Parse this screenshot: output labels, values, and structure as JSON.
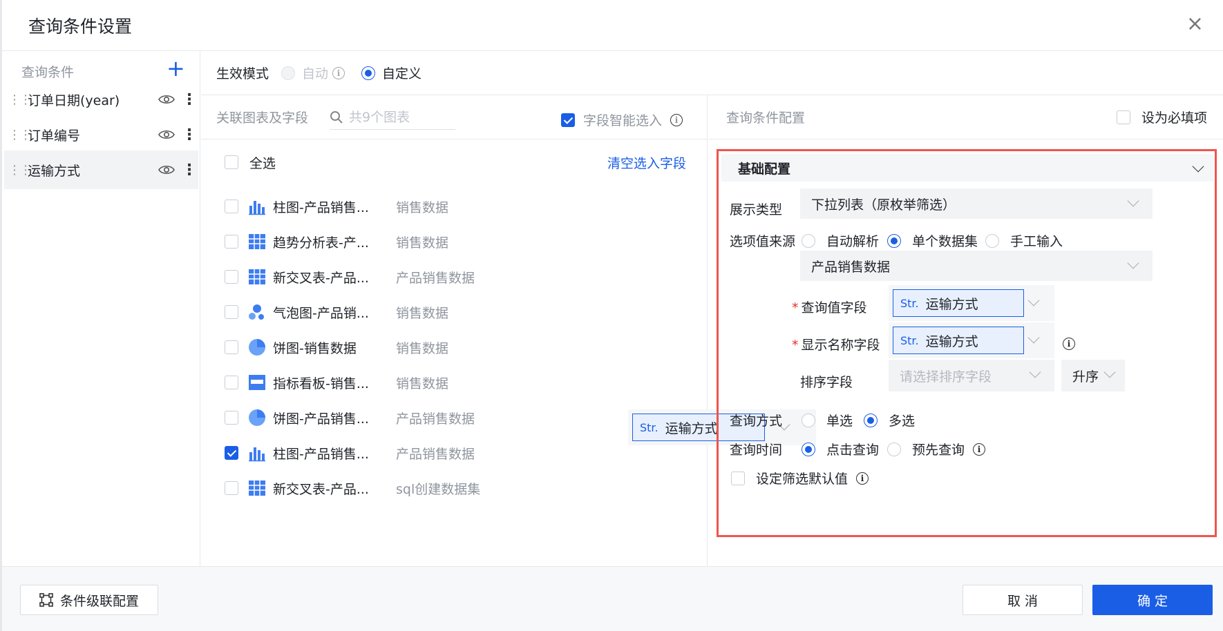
{
  "dialog": {
    "title": "查询条件设置",
    "close_glyph": "×"
  },
  "left": {
    "header": "查询条件",
    "add_glyph": "+",
    "items": [
      {
        "label": "订单日期(year)"
      },
      {
        "label": "订单编号"
      },
      {
        "label": "运输方式"
      }
    ],
    "drag_glyph": "⋮⋮",
    "more_glyph": "⋮"
  },
  "mode": {
    "label": "生效模式",
    "auto": "自动",
    "custom": "自定义",
    "selected": "自定义"
  },
  "mid": {
    "header": "关联图表及字段",
    "search_placeholder": "共9个图表",
    "smart_label": "字段智能选入",
    "select_all": "全选",
    "clear": "清空选入字段",
    "rows": [
      {
        "name": "柱图-产品销售...",
        "dataset": "销售数据",
        "icon": "bar-chart-icon",
        "checked": false
      },
      {
        "name": "趋势分析表-产...",
        "dataset": "销售数据",
        "icon": "table-icon",
        "checked": false
      },
      {
        "name": "新交叉表-产品...",
        "dataset": "产品销售数据",
        "icon": "table-icon",
        "checked": false
      },
      {
        "name": "气泡图-产品销...",
        "dataset": "销售数据",
        "icon": "bubble-chart-icon",
        "checked": false
      },
      {
        "name": "饼图-销售数据",
        "dataset": "销售数据",
        "icon": "pie-chart-icon",
        "checked": false
      },
      {
        "name": "指标看板-销售...",
        "dataset": "销售数据",
        "icon": "kpi-board-icon",
        "checked": false
      },
      {
        "name": "饼图-产品销售...",
        "dataset": "产品销售数据",
        "icon": "pie-chart-icon",
        "checked": false
      },
      {
        "name": "柱图-产品销售...",
        "dataset": "产品销售数据",
        "icon": "bar-chart-icon",
        "checked": true
      },
      {
        "name": "新交叉表-产品...",
        "dataset": "sql创建数据集",
        "icon": "table-icon",
        "checked": false
      }
    ],
    "field_selector": {
      "type": "Str.",
      "value": "运输方式"
    }
  },
  "right": {
    "header": "查询条件配置",
    "required_label": "设为必填项",
    "section": "基础配置",
    "display_type": {
      "label": "展示类型",
      "value": "下拉列表（原枚举筛选）"
    },
    "source": {
      "label": "选项值来源",
      "options": [
        "自动解析",
        "单个数据集",
        "手工输入"
      ],
      "selected": "单个数据集"
    },
    "dataset": {
      "value": "产品销售数据"
    },
    "query_field": {
      "label": "查询值字段",
      "type": "Str.",
      "value": "运输方式"
    },
    "display_field": {
      "label": "显示名称字段",
      "type": "Str.",
      "value": "运输方式"
    },
    "sort_field": {
      "label": "排序字段",
      "placeholder": "请选择排序字段",
      "order": "升序"
    },
    "query_mode": {
      "label": "查询方式",
      "options": [
        "单选",
        "多选"
      ],
      "selected": "多选"
    },
    "query_time": {
      "label": "查询时间",
      "options": [
        "点击查询",
        "预先查询"
      ],
      "selected": "点击查询"
    },
    "default_value": {
      "label": "设定筛选默认值"
    }
  },
  "footer": {
    "cascade": "条件级联配置",
    "cancel": "取 消",
    "confirm": "确 定"
  },
  "colors": {
    "accent": "#1a5ee6",
    "highlight_border": "#f0544c"
  }
}
